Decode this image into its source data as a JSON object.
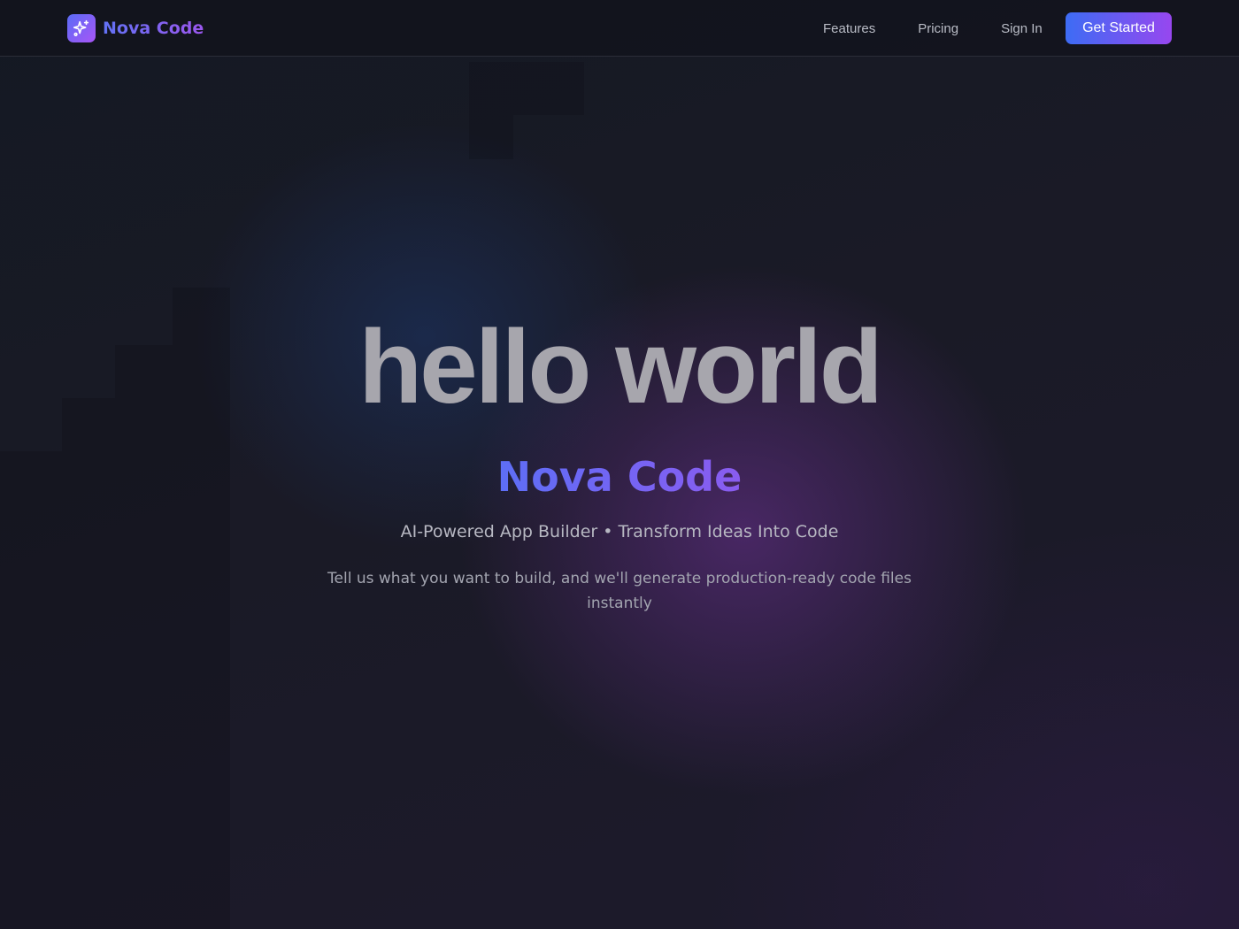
{
  "brand": {
    "name": "Nova Code",
    "logo_icon": "sparkles-icon"
  },
  "nav": {
    "links": [
      {
        "label": "Features"
      },
      {
        "label": "Pricing"
      },
      {
        "label": "Sign In"
      }
    ],
    "cta_label": "Get Started"
  },
  "hero": {
    "title": "hello world",
    "brand_heading": "Nova Code",
    "tagline": "AI-Powered App Builder • Transform Ideas Into Code",
    "description": "Tell us what you want to build, and we'll generate production-ready code files instantly"
  },
  "colors": {
    "accent_start": "#3d6cf4",
    "accent_end": "#9747ef",
    "background": "#16161f"
  }
}
